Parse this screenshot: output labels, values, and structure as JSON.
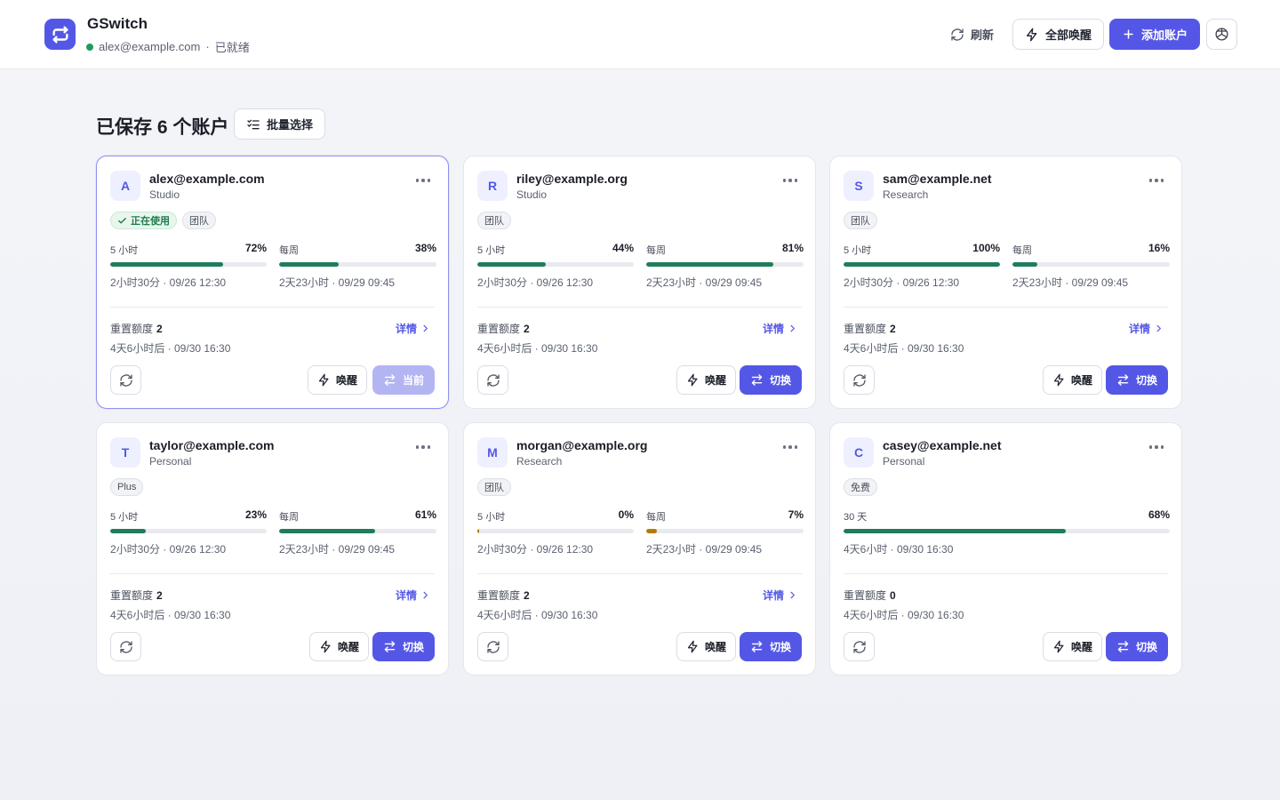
{
  "header": {
    "app_name": "GSwitch",
    "current_email": "alex@example.com",
    "separator": "·",
    "status": "已就绪",
    "refresh_label": "刷新",
    "wake_all_label": "全部唤醒",
    "add_account_label": "添加账户"
  },
  "section": {
    "title": "已保存 6 个账户",
    "batch_select_label": "批量选择"
  },
  "colors": {
    "accent": "#5457e6",
    "progress_green": "#1f7d5a",
    "progress_amber": "#b8790b",
    "active_green": "#1f9a5a"
  },
  "labels": {
    "reset_quota": "重置额度",
    "details": "详情",
    "wake": "唤醒",
    "switch": "切换",
    "current": "当前"
  },
  "cards": [
    {
      "initial": "A",
      "email": "alex@example.com",
      "org": "Studio",
      "active": true,
      "badges": [
        {
          "text": "正在使用",
          "style": "green",
          "icon": "check-icon"
        },
        {
          "text": "团队",
          "style": "plain"
        }
      ],
      "meters": [
        {
          "label": "5 小时",
          "percent": "72%",
          "value": 72,
          "when": "2小时30分 · 09/26 12:30",
          "color": "green"
        },
        {
          "label": "每周",
          "percent": "38%",
          "value": 38,
          "when": "2天23小时 · 09/29 09:45",
          "color": "green"
        }
      ],
      "reset_count": "2",
      "reset_time": "4天6小时后 · 09/30 16:30",
      "show_details": true,
      "action": "current"
    },
    {
      "initial": "R",
      "email": "riley@example.org",
      "org": "Studio",
      "active": false,
      "badges": [
        {
          "text": "团队",
          "style": "plain"
        }
      ],
      "meters": [
        {
          "label": "5 小时",
          "percent": "44%",
          "value": 44,
          "when": "2小时30分 · 09/26 12:30",
          "color": "green"
        },
        {
          "label": "每周",
          "percent": "81%",
          "value": 81,
          "when": "2天23小时 · 09/29 09:45",
          "color": "green"
        }
      ],
      "reset_count": "2",
      "reset_time": "4天6小时后 · 09/30 16:30",
      "show_details": true,
      "action": "switch"
    },
    {
      "initial": "S",
      "email": "sam@example.net",
      "org": "Research",
      "active": false,
      "badges": [
        {
          "text": "团队",
          "style": "plain"
        }
      ],
      "meters": [
        {
          "label": "5 小时",
          "percent": "100%",
          "value": 100,
          "when": "2小时30分 · 09/26 12:30",
          "color": "green"
        },
        {
          "label": "每周",
          "percent": "16%",
          "value": 16,
          "when": "2天23小时 · 09/29 09:45",
          "color": "green"
        }
      ],
      "reset_count": "2",
      "reset_time": "4天6小时后 · 09/30 16:30",
      "show_details": true,
      "action": "switch"
    },
    {
      "initial": "T",
      "email": "taylor@example.com",
      "org": "Personal",
      "active": false,
      "badges": [
        {
          "text": "Plus",
          "style": "plain"
        }
      ],
      "meters": [
        {
          "label": "5 小时",
          "percent": "23%",
          "value": 23,
          "when": "2小时30分 · 09/26 12:30",
          "color": "green"
        },
        {
          "label": "每周",
          "percent": "61%",
          "value": 61,
          "when": "2天23小时 · 09/29 09:45",
          "color": "green"
        }
      ],
      "reset_count": "2",
      "reset_time": "4天6小时后 · 09/30 16:30",
      "show_details": true,
      "action": "switch"
    },
    {
      "initial": "M",
      "email": "morgan@example.org",
      "org": "Research",
      "active": false,
      "badges": [
        {
          "text": "团队",
          "style": "plain"
        }
      ],
      "meters": [
        {
          "label": "5 小时",
          "percent": "0%",
          "value": 1,
          "when": "2小时30分 · 09/26 12:30",
          "color": "amber"
        },
        {
          "label": "每周",
          "percent": "7%",
          "value": 7,
          "when": "2天23小时 · 09/29 09:45",
          "color": "amber"
        }
      ],
      "reset_count": "2",
      "reset_time": "4天6小时后 · 09/30 16:30",
      "show_details": true,
      "action": "switch"
    },
    {
      "initial": "C",
      "email": "casey@example.net",
      "org": "Personal",
      "active": false,
      "badges": [
        {
          "text": "免费",
          "style": "plain"
        }
      ],
      "meters": [
        {
          "label": "30 天",
          "percent": "68%",
          "value": 68,
          "when": "4天6小时 · 09/30 16:30",
          "color": "green",
          "wide": true
        }
      ],
      "reset_count": "0",
      "reset_time": "4天6小时后 · 09/30 16:30",
      "show_details": false,
      "action": "switch"
    }
  ]
}
